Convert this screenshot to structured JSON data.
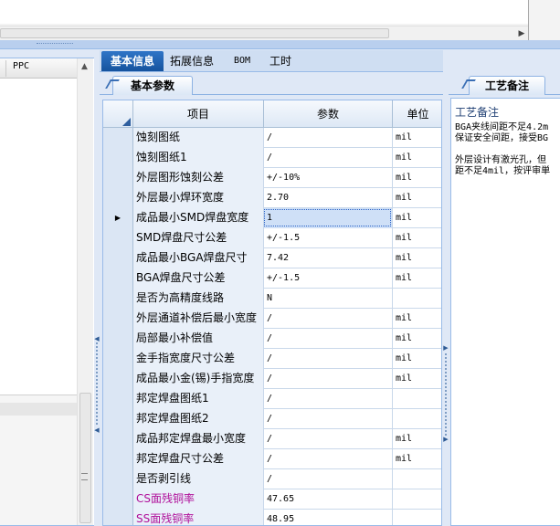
{
  "left_panel": {
    "column_header": "PPC"
  },
  "tabs": [
    {
      "label": "基本信息",
      "active": true
    },
    {
      "label": "拓展信息",
      "active": false
    },
    {
      "label": "BOM",
      "active": false
    },
    {
      "label": "工时",
      "active": false
    }
  ],
  "subtab": {
    "label": "基本参数"
  },
  "grid": {
    "headers": {
      "item": "项目",
      "param": "参数",
      "unit": "单位"
    },
    "current_row_marker": "▶",
    "rows": [
      {
        "item": "蚀刻图纸",
        "param": "/",
        "unit": "mil"
      },
      {
        "item": "蚀刻图纸1",
        "param": "/",
        "unit": "mil"
      },
      {
        "item": "外层图形蚀刻公差",
        "param": "+/-10%",
        "unit": "mil"
      },
      {
        "item": "外层最小焊环宽度",
        "param": "2.70",
        "unit": "mil"
      },
      {
        "item": "成品最小SMD焊盘宽度",
        "param": "1",
        "unit": "mil"
      },
      {
        "item": "SMD焊盘尺寸公差",
        "param": "+/-1.5",
        "unit": "mil"
      },
      {
        "item": "成品最小BGA焊盘尺寸",
        "param": "7.42",
        "unit": "mil"
      },
      {
        "item": "BGA焊盘尺寸公差",
        "param": "+/-1.5",
        "unit": "mil"
      },
      {
        "item": "是否为高精度线路",
        "param": "N",
        "unit": ""
      },
      {
        "item": "外层通道补偿后最小宽度",
        "param": "/",
        "unit": "mil"
      },
      {
        "item": "局部最小补偿值",
        "param": "/",
        "unit": "mil"
      },
      {
        "item": "金手指宽度尺寸公差",
        "param": "/",
        "unit": "mil"
      },
      {
        "item": "成品最小金(锡)手指宽度",
        "param": "/",
        "unit": "mil"
      },
      {
        "item": "邦定焊盘图纸1",
        "param": "/",
        "unit": ""
      },
      {
        "item": "邦定焊盘图纸2",
        "param": "/",
        "unit": ""
      },
      {
        "item": "成品邦定焊盘最小宽度",
        "param": "/",
        "unit": "mil"
      },
      {
        "item": "邦定焊盘尺寸公差",
        "param": "/",
        "unit": "mil"
      },
      {
        "item": "是否剥引线",
        "param": "/",
        "unit": ""
      },
      {
        "item": "CS面残铜率",
        "param": "47.65",
        "unit": ""
      },
      {
        "item": "SS面残铜率",
        "param": "48.95",
        "unit": ""
      }
    ]
  },
  "right_panel": {
    "tab": "工艺备注",
    "title": "工艺备注",
    "note_lines": [
      "BGA夹线间距不足4.2m",
      "保证安全间距，接受BG",
      "",
      "外层设计有激光孔，但",
      "距不足4mil，按评审単"
    ]
  },
  "colors": {
    "accent": "#15539e",
    "pink_text": "#b0109a",
    "panel_bg": "#dfe8f6"
  }
}
